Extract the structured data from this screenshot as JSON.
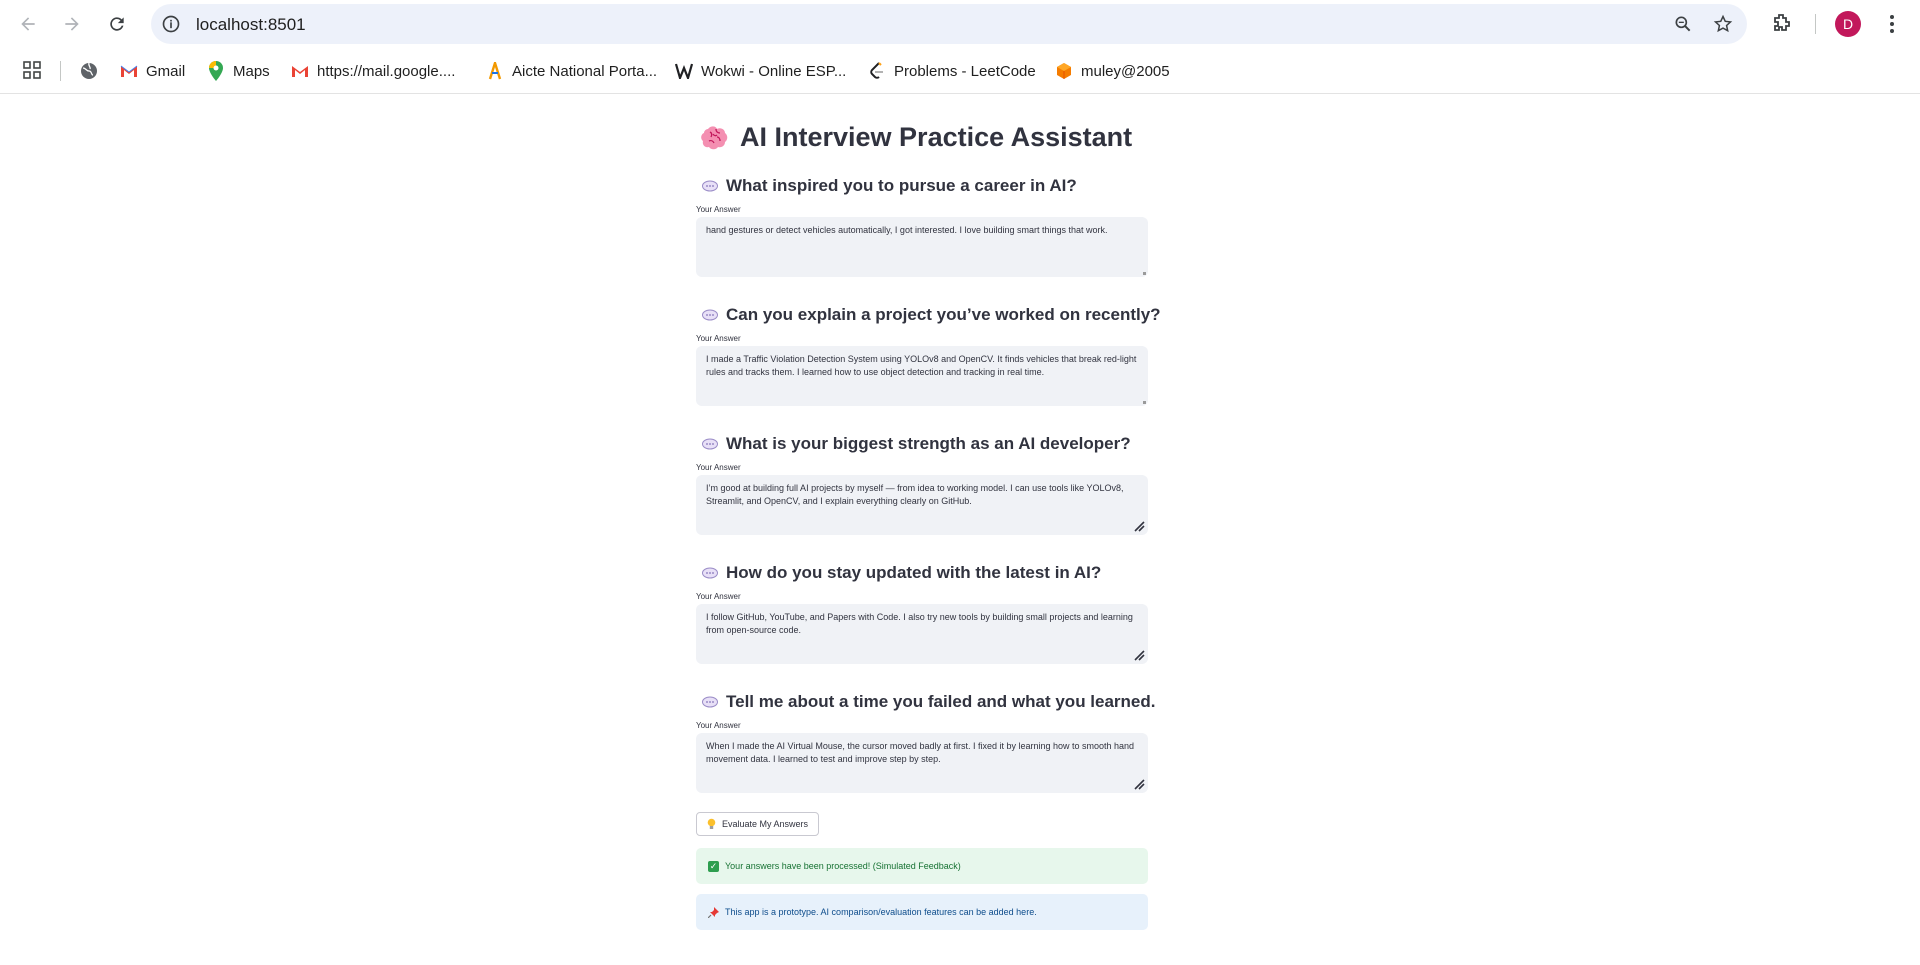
{
  "browser": {
    "url": "localhost:8501",
    "avatar_letter": "D",
    "avatar_color": "#c2185b",
    "bookmarks": [
      {
        "label": "",
        "icon": "globe-icon"
      },
      {
        "label": "Gmail",
        "icon": "gmail-icon"
      },
      {
        "label": "Maps",
        "icon": "maps-icon"
      },
      {
        "label": "https://mail.google....",
        "icon": "gmail-icon"
      },
      {
        "label": "Aicte National Porta...",
        "icon": "aicte-icon"
      },
      {
        "label": "Wokwi - Online ESP...",
        "icon": "wokwi-icon"
      },
      {
        "label": "Problems - LeetCode",
        "icon": "leetcode-icon"
      },
      {
        "label": "muley@2005",
        "icon": "cube-icon"
      }
    ]
  },
  "app": {
    "title": "AI Interview Practice Assistant",
    "title_icon": "brain-icon",
    "answer_label": "Your Answer",
    "questions": [
      {
        "question": "What inspired you to pursue a career in AI?",
        "answer": "hand gestures or detect vehicles automatically, I got interested. I love building smart things that work."
      },
      {
        "question": "Can you explain a project you’ve worked on recently?",
        "answer": "I made a Traffic Violation Detection System using YOLOv8 and OpenCV. It finds vehicles that break red-light rules and tracks them. I learned how to use object detection and tracking in real time."
      },
      {
        "question": "What is your biggest strength as an AI developer?",
        "answer": "I’m good at building full AI projects by myself — from idea to working model. I can use tools like YOLOv8, Streamlit, and OpenCV, and I explain everything clearly on GitHub."
      },
      {
        "question": "How do you stay updated with the latest in AI?",
        "answer": "I follow GitHub, YouTube, and Papers with Code. I also try new tools by building small projects and learning from open-source code."
      },
      {
        "question": "Tell me about a time you failed and what you learned.",
        "answer": "When I made the AI Virtual Mouse, the cursor moved badly at first. I fixed it by learning how to smooth hand movement data. I learned to test and improve step by step."
      }
    ],
    "evaluate_button": "Evaluate My Answers",
    "evaluate_icon": "lightbulb-icon",
    "success_message": "Your answers have been processed! (Simulated Feedback)",
    "info_message": "This app is a prototype. AI comparison/evaluation features can be added here.",
    "colors": {
      "success_bg": "#e7f7ec",
      "success_text": "#177233",
      "info_bg": "#e7f1fb",
      "info_text": "#0e4d8c",
      "input_bg": "#f0f2f6"
    }
  }
}
